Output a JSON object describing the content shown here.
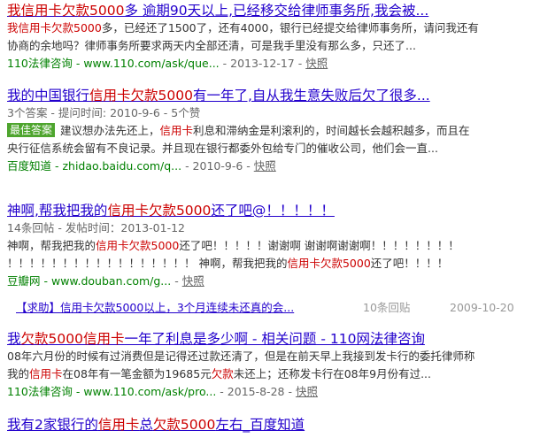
{
  "results": [
    {
      "title_parts": [
        {
          "text": "我信用卡欠款5000",
          "hl": true
        },
        {
          "text": "多 逾期90天以上,已经移交给律师事务所,我会被...",
          "hl": false
        }
      ],
      "abstract_lines": [
        [
          {
            "text": "我信用卡欠款5000",
            "hl": true
          },
          {
            "text": "多，已经还了1500了，还有4000，银行已经提交给律师事务所，请问我还有",
            "hl": false
          }
        ],
        [
          {
            "text": "协商的余地吗？律师事务所要求两天内全部还清，可是我手里没有那么多，只还了...",
            "hl": false
          }
        ]
      ],
      "source": "110法律咨询",
      "url": " - www.110.com/ask/que...",
      "date": " - 2013-12-17 - ",
      "snapshot": "快照"
    },
    {
      "title_parts": [
        {
          "text": "我的中国银行",
          "hl": false
        },
        {
          "text": "信用卡欠款5000",
          "hl": true
        },
        {
          "text": "有一年了,自从我生意失败后欠了很多...",
          "hl": false
        }
      ],
      "meta": "3个答案 - 提问时间: 2010-9-6 - 5个赞",
      "badge": "最佳答案",
      "abstract_lines": [
        [
          {
            "text": "建议想办法先还上，",
            "hl": false
          },
          {
            "text": "信用卡",
            "hl": true
          },
          {
            "text": "利息和滞纳金是利滚利的，时间越长会越积越多，而且在",
            "hl": false
          }
        ],
        [
          {
            "text": "央行征信系统会留有不良记录。并且现在银行都委外包给专门的催收公司，他们会一直...",
            "hl": false
          }
        ]
      ],
      "source": "百度知道",
      "url": " - zhidao.baidu.com/q...",
      "date": " - 2010-9-6 - ",
      "snapshot": "快照"
    },
    {
      "title_parts": [
        {
          "text": "神啊,帮我把我的",
          "hl": false
        },
        {
          "text": "信用卡欠款5000",
          "hl": true
        },
        {
          "text": "还了吧@！！！！！",
          "hl": false
        }
      ],
      "meta": "14条回帖 - 发帖时间：2013-01-12",
      "abstract_lines": [
        [
          {
            "text": "神啊，帮我把我的",
            "hl": false
          },
          {
            "text": "信用卡欠款5000",
            "hl": true
          },
          {
            "text": "还了吧！！！！！谢谢啊 谢谢啊谢谢啊！！！！！！！！",
            "hl": false
          }
        ],
        [
          {
            "text": "！！！！！！！！！！！！！！！！！ 神啊，帮我把我的",
            "hl": false
          },
          {
            "text": "信用卡欠款5000",
            "hl": true
          },
          {
            "text": "还了吧！！！！",
            "hl": false
          }
        ]
      ],
      "source": "豆瓣网",
      "url": " - www.douban.com/g...",
      "date": " - ",
      "snapshot": "快照",
      "subrow": {
        "title_parts": [
          {
            "text": "【求助】",
            "hl": false
          },
          {
            "text": "信用卡欠款5000",
            "hl": true
          },
          {
            "text": "以上，3个月连续未还真的会...",
            "hl": false
          }
        ],
        "count": "10条回贴",
        "date": "2009-10-20"
      }
    },
    {
      "title_parts": [
        {
          "text": "我",
          "hl": false
        },
        {
          "text": "欠款5000信用卡",
          "hl": true
        },
        {
          "text": "一年了利息是多少啊 - 相关问题 - 110网法律咨询",
          "hl": false
        }
      ],
      "abstract_lines": [
        [
          {
            "text": "08年六月份的时候有过消费但是记得还过款还清了，但是在前天早上我接到发卡行的委托律师称",
            "hl": false
          }
        ],
        [
          {
            "text": "我的",
            "hl": false
          },
          {
            "text": "信用卡",
            "hl": true
          },
          {
            "text": "在08年有一笔金额为19685元",
            "hl": false
          },
          {
            "text": "欠款",
            "hl": true
          },
          {
            "text": "未还上；还称发卡行在08年9月份有过...",
            "hl": false
          }
        ]
      ],
      "source": "110法律咨询",
      "url": " - www.110.com/ask/pro...",
      "date": " - 2015-8-28 - ",
      "snapshot": "快照"
    },
    {
      "title_parts": [
        {
          "text": "我有2家银行的",
          "hl": false
        },
        {
          "text": "信用卡",
          "hl": true
        },
        {
          "text": "总",
          "hl": false
        },
        {
          "text": "欠款5000",
          "hl": true
        },
        {
          "text": "左右_百度知道",
          "hl": false
        }
      ]
    }
  ],
  "colors": {
    "link": "#2200cc",
    "highlight": "#cc0000",
    "source": "#008000",
    "badge_bg": "#4ea52e"
  }
}
